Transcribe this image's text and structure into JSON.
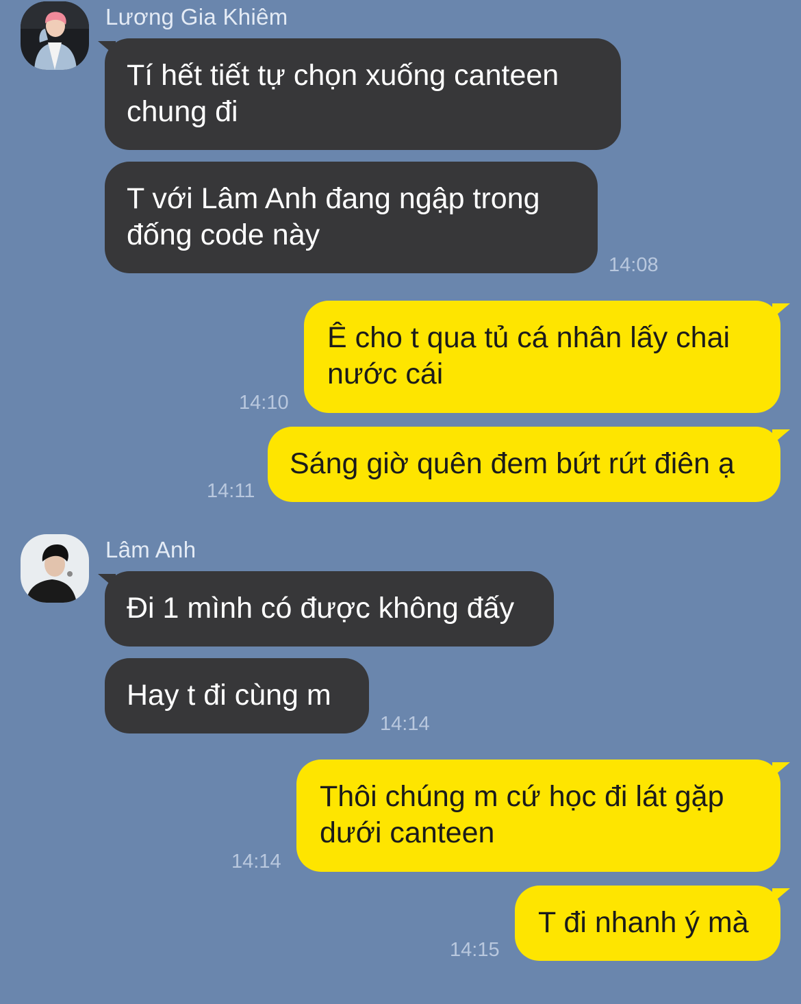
{
  "conversation": {
    "senders": [
      {
        "name": "Lương Gia Khiêm",
        "avatar": "person-photo-avatar"
      },
      {
        "name": "Lâm Anh",
        "avatar": "person-photo-avatar"
      }
    ],
    "messages": [
      {
        "from": "Lương Gia Khiêm",
        "text": "Tí hết tiết tự chọn xuống canteen chung đi"
      },
      {
        "from": "Lương Gia Khiêm",
        "text": "T với Lâm Anh đang ngập trong đống code này",
        "time": "14:08"
      },
      {
        "from": "me",
        "text": "Ê cho t qua tủ cá nhân lấy chai nước cái",
        "time": "14:10"
      },
      {
        "from": "me",
        "text": "Sáng giờ quên đem bứt rứt điên ạ",
        "time": "14:11"
      },
      {
        "from": "Lâm Anh",
        "text": "Đi 1 mình có được không đấy"
      },
      {
        "from": "Lâm Anh",
        "text": "Hay t đi cùng m",
        "time": "14:14"
      },
      {
        "from": "me",
        "text": "Thôi chúng m cứ học đi lát gặp dưới canteen",
        "time": "14:14"
      },
      {
        "from": "me",
        "text": "T đi nhanh ý mà",
        "time": "14:15"
      }
    ]
  },
  "colors": {
    "background": "#6a86ad",
    "incoming_bubble": "#373739",
    "outgoing_bubble": "#fee500"
  }
}
